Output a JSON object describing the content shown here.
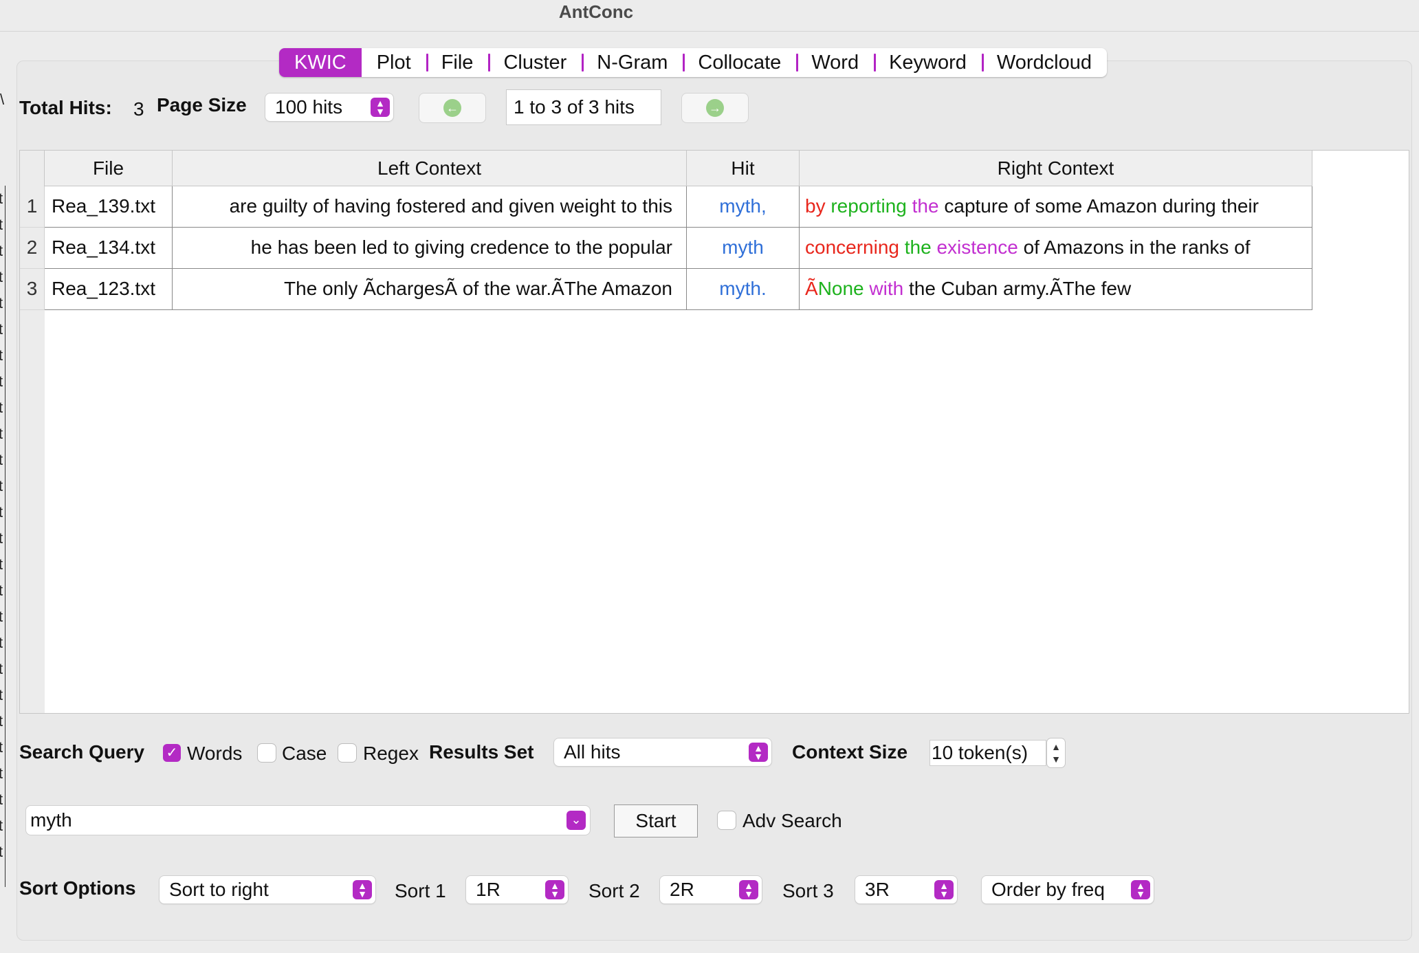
{
  "window": {
    "title": "AntConc"
  },
  "tabs": [
    {
      "label": "KWIC",
      "active": true
    },
    {
      "label": "Plot"
    },
    {
      "label": "File"
    },
    {
      "label": "Cluster"
    },
    {
      "label": "N-Gram"
    },
    {
      "label": "Collocate"
    },
    {
      "label": "Word"
    },
    {
      "label": "Keyword"
    },
    {
      "label": "Wordcloud"
    }
  ],
  "toolbar": {
    "total_hits_label": "Total Hits:",
    "total_hits_value": "3",
    "page_size_label": "Page Size",
    "page_size_value": "100 hits",
    "hits_range": "1 to 3 of 3 hits"
  },
  "table": {
    "headers": [
      "File",
      "Left Context",
      "Hit",
      "Right Context"
    ],
    "rows": [
      {
        "num": "1",
        "file": "Rea_139.txt",
        "left": "are guilty of having fostered and given weight to this",
        "hit": "myth,",
        "right": [
          {
            "text": "by",
            "color": "red"
          },
          {
            "text": "reporting",
            "color": "green"
          },
          {
            "text": "the",
            "color": "magenta"
          },
          {
            "text": "capture of some Amazon during their",
            "color": "black"
          }
        ]
      },
      {
        "num": "2",
        "file": "Rea_134.txt",
        "left": "he has been led to giving credence to the popular",
        "hit": "myth",
        "right": [
          {
            "text": "concerning",
            "color": "red"
          },
          {
            "text": "the",
            "color": "green"
          },
          {
            "text": "existence",
            "color": "magenta"
          },
          {
            "text": "of Amazons in the ranks of",
            "color": "black"
          }
        ]
      },
      {
        "num": "3",
        "file": "Rea_123.txt",
        "left": "The only ÃchargesÃ of the war.ÃThe Amazon",
        "hit": "myth.",
        "right": [
          {
            "text": "Ã",
            "color": "red"
          },
          {
            "text": "None",
            "color": "green"
          },
          {
            "text": "with",
            "color": "magenta"
          },
          {
            "text": "the Cuban army.ÃThe few",
            "color": "black"
          }
        ]
      }
    ]
  },
  "search": {
    "query_label": "Search Query",
    "words_label": "Words",
    "words_checked": true,
    "case_label": "Case",
    "case_checked": false,
    "regex_label": "Regex",
    "regex_checked": false,
    "results_set_label": "Results Set",
    "results_set_value": "All hits",
    "context_size_label": "Context Size",
    "context_size_value": "10 token(s)",
    "query_value": "myth",
    "start_label": "Start",
    "adv_search_label": "Adv Search",
    "adv_search_checked": false
  },
  "sort": {
    "options_label": "Sort Options",
    "options_value": "Sort to right",
    "sort1_label": "Sort 1",
    "sort1_value": "1R",
    "sort2_label": "Sort 2",
    "sort2_value": "2R",
    "sort3_label": "Sort 3",
    "sort3_value": "3R",
    "order_value": "Order by freq"
  },
  "left_strip_glyphs": [
    "t",
    "t",
    "t",
    "t",
    "t",
    "t",
    "t",
    "t",
    "t",
    "t",
    "t",
    "t",
    "t",
    "t",
    "t",
    "t",
    "t",
    "t",
    "t",
    "t",
    "t",
    "t",
    "t",
    "t",
    "t",
    "t"
  ],
  "corner_glyph": "\\",
  "colors": {
    "accent": "#b32ac4",
    "hit": "#2f6fd8",
    "red": "#e8261c",
    "green": "#1db21d",
    "magenta": "#c22fd0"
  }
}
